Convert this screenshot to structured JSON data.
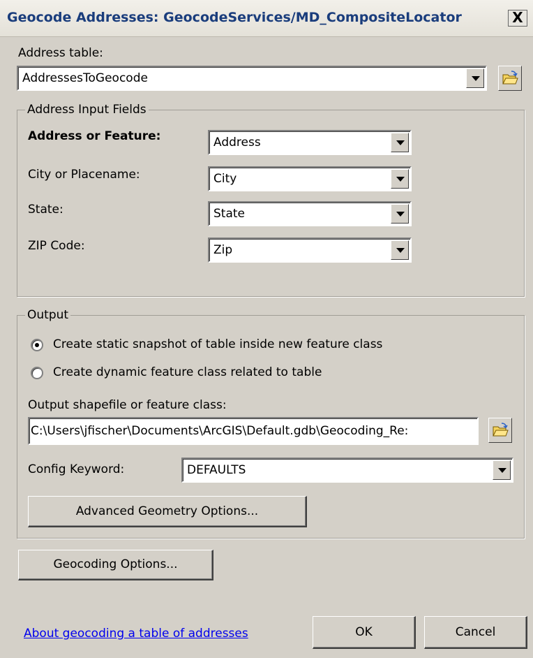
{
  "window": {
    "title": "Geocode Addresses:  GeocodeServices/MD_CompositeLocator",
    "close_glyph": "X"
  },
  "address_table": {
    "label": "Address table:",
    "value": "AddressesToGeocode"
  },
  "input_fields": {
    "group_title": "Address Input Fields",
    "rows": [
      {
        "label": "Address or Feature:",
        "value": "Address",
        "bold": true
      },
      {
        "label": "City or Placename:",
        "value": "City",
        "bold": false
      },
      {
        "label": "State:",
        "value": "State",
        "bold": false
      },
      {
        "label": "ZIP Code:",
        "value": "Zip",
        "bold": false
      }
    ]
  },
  "output": {
    "group_title": "Output",
    "radio_options": [
      {
        "label": "Create static snapshot of table inside new feature class",
        "selected": true
      },
      {
        "label": "Create dynamic feature class related to table",
        "selected": false
      }
    ],
    "path_label": "Output shapefile or feature class:",
    "path_value": "C:\\Users\\jfischer\\Documents\\ArcGIS\\Default.gdb\\Geocoding_Re:",
    "config_label": "Config Keyword:",
    "config_value": "DEFAULTS",
    "advanced_button": "Advanced Geometry Options..."
  },
  "buttons": {
    "geocoding_options": "Geocoding Options...",
    "ok": "OK",
    "cancel": "Cancel"
  },
  "help_link": "About geocoding a table of addresses",
  "icons": {
    "folder": "open-folder-icon",
    "dropdown": "chevron-down-icon",
    "close": "close-icon"
  }
}
